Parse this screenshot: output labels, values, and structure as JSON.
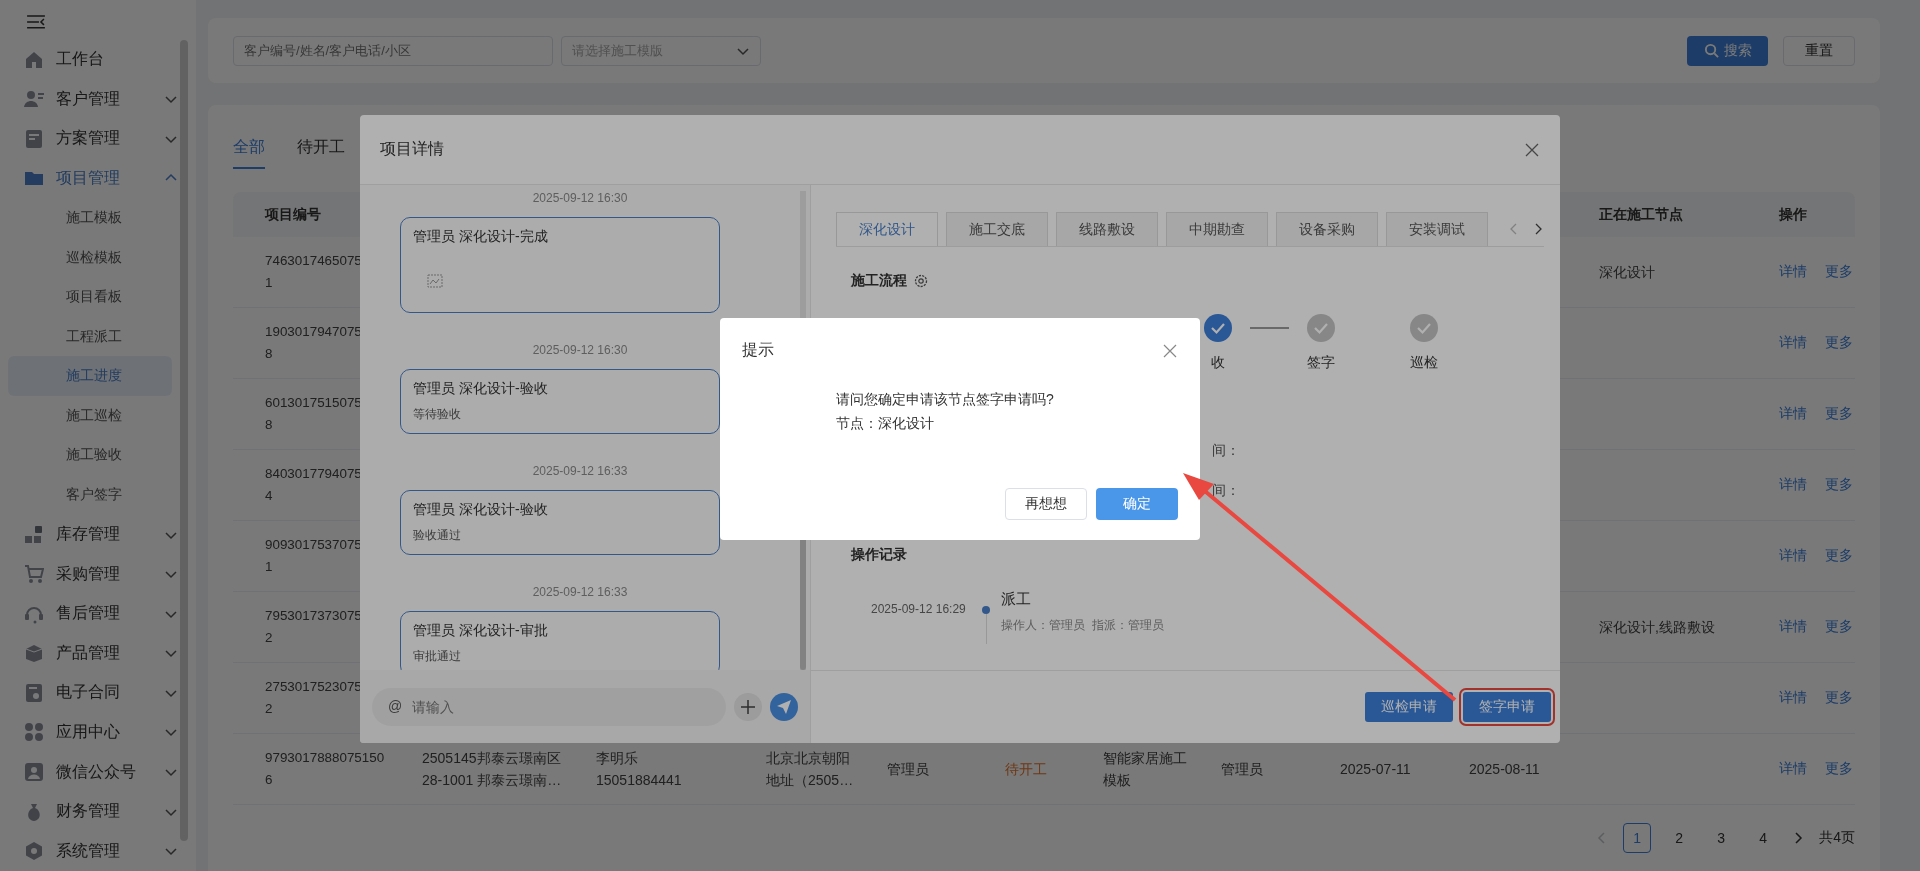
{
  "sidebar": {
    "items": [
      {
        "label": "工作台",
        "kind": "link"
      },
      {
        "label": "客户管理",
        "kind": "group",
        "expanded": false
      },
      {
        "label": "方案管理",
        "kind": "group",
        "expanded": false
      },
      {
        "label": "项目管理",
        "kind": "group",
        "expanded": true,
        "children": [
          {
            "label": "施工模板",
            "selected": false
          },
          {
            "label": "巡检模板",
            "selected": false
          },
          {
            "label": "项目看板",
            "selected": false
          },
          {
            "label": "工程派工",
            "selected": false
          },
          {
            "label": "施工进度",
            "selected": true
          },
          {
            "label": "施工巡检",
            "selected": false
          },
          {
            "label": "施工验收",
            "selected": false
          },
          {
            "label": "客户签字",
            "selected": false
          }
        ]
      },
      {
        "label": "库存管理",
        "kind": "group",
        "expanded": false
      },
      {
        "label": "采购管理",
        "kind": "group",
        "expanded": false
      },
      {
        "label": "售后管理",
        "kind": "group",
        "expanded": false
      },
      {
        "label": "产品管理",
        "kind": "group",
        "expanded": false
      },
      {
        "label": "电子合同",
        "kind": "group",
        "expanded": false
      },
      {
        "label": "应用中心",
        "kind": "group",
        "expanded": false
      },
      {
        "label": "微信公众号",
        "kind": "group",
        "expanded": false
      },
      {
        "label": "财务管理",
        "kind": "group",
        "expanded": false
      },
      {
        "label": "系统管理",
        "kind": "group",
        "expanded": false
      }
    ]
  },
  "search": {
    "keyword_placeholder": "客户编号/姓名/客户电话/小区",
    "template_placeholder": "请选择施工模版",
    "search_button": "搜索",
    "reset_button": "重置"
  },
  "tabs": [
    {
      "label": "全部",
      "selected": true
    },
    {
      "label": "待开工",
      "selected": false
    }
  ],
  "table": {
    "columns": [
      {
        "label": "项目编号"
      },
      {
        "label": "正在施工节点"
      },
      {
        "label": "操作"
      }
    ],
    "rows": [
      {
        "project_no": [
          "7463017465075",
          "1"
        ],
        "current_node": "深化设计",
        "actions": [
          "详情",
          "更多"
        ]
      },
      {
        "project_no": [
          "1903017947075",
          "8"
        ],
        "actions": [
          "详情",
          "更多"
        ]
      },
      {
        "project_no": [
          "6013017515075",
          "8"
        ],
        "actions": [
          "详情",
          "更多"
        ]
      },
      {
        "project_no": [
          "8403017794075",
          "4"
        ],
        "actions": [
          "详情",
          "更多"
        ]
      },
      {
        "project_no": [
          "9093017537075",
          "1"
        ],
        "actions": [
          "详情",
          "更多"
        ]
      },
      {
        "project_no": [
          "7953017373075",
          "2"
        ],
        "current_node": "深化设计,线路敷设",
        "actions": [
          "详情",
          "更多"
        ]
      },
      {
        "project_no": [
          "2753017523075",
          "2"
        ],
        "actions": [
          "详情",
          "更多"
        ]
      },
      {
        "project_no": [
          "9793017888075150",
          "6"
        ],
        "customer": [
          "2505145邦泰云璟南区",
          "28-1001 邦泰云璟南…"
        ],
        "contact": [
          "李明乐",
          "15051884441"
        ],
        "address": [
          "北京北京朝阳",
          "地址（2505…"
        ],
        "manager": "管理员",
        "status": "待开工",
        "template": [
          "智能家居施工",
          "模板"
        ],
        "builder": "管理员",
        "start_date": "2025-07-11",
        "end_date": "2025-08-11",
        "actions": [
          "详情",
          "更多"
        ]
      }
    ]
  },
  "pagination": {
    "prev_disabled": true,
    "pages": [
      {
        "label": "1",
        "selected": true
      },
      {
        "label": "2",
        "selected": false
      },
      {
        "label": "3",
        "selected": false
      },
      {
        "label": "4",
        "selected": false
      }
    ],
    "total": "共4页"
  },
  "project_modal": {
    "title": "项目详情",
    "chat": {
      "messages": [
        {
          "time": "2025-09-12 16:30",
          "title": "管理员 深化设计-完成",
          "kind": "image"
        },
        {
          "time": "2025-09-12 16:30",
          "title": "管理员 深化设计-验收",
          "kind": "text",
          "body": "等待验收"
        },
        {
          "time": "2025-09-12 16:33",
          "title": "管理员 深化设计-验收",
          "kind": "text",
          "body": "验收通过"
        },
        {
          "time": "2025-09-12 16:33",
          "title": "管理员 深化设计-审批",
          "kind": "text",
          "body": "审批通过"
        }
      ],
      "at_sign": "@",
      "input_placeholder": "请输入"
    },
    "detail": {
      "tabs": [
        {
          "label": "深化设计",
          "selected": true
        },
        {
          "label": "施工交底",
          "selected": false
        },
        {
          "label": "线路敷设",
          "selected": false
        },
        {
          "label": "中期勘查",
          "selected": false
        },
        {
          "label": "设备采购",
          "selected": false
        },
        {
          "label": "安装调试",
          "selected": false
        }
      ],
      "flow_title": "施工流程",
      "steps": [
        {
          "label": "收",
          "done": true
        },
        {
          "label": "签字",
          "done": false
        },
        {
          "label": "巡检",
          "done": false
        }
      ],
      "time_labels": [
        "间：",
        "间："
      ],
      "records_title": "操作记录",
      "records": [
        {
          "time": "2025-09-12 16:29",
          "title": "派工",
          "detail": "操作人：管理员  指派：管理员"
        }
      ]
    },
    "buttons": [
      {
        "label": "巡检申请",
        "highlighted": false
      },
      {
        "label": "签字申请",
        "highlighted": true
      }
    ]
  },
  "confirm_dialog": {
    "title": "提示",
    "lines": [
      "请问您确定申请该节点签字申请吗?",
      "节点：深化设计"
    ],
    "cancel": "再想想",
    "ok": "确定"
  }
}
